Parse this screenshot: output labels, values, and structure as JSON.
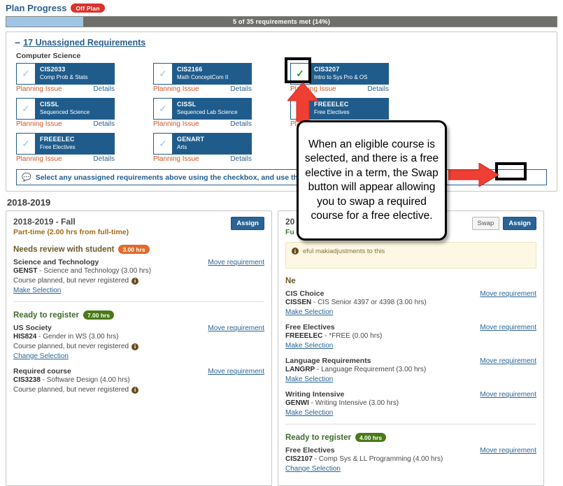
{
  "header": {
    "title": "Plan Progress",
    "badge": "Off Plan"
  },
  "progress": {
    "label": "5 of 35 requirements met (14%)",
    "percent": 14,
    "fill_color": "#9ec6e4",
    "track_color": "#6f6f6b"
  },
  "unassigned": {
    "collapse_icon": "minus-icon",
    "heading": "17 Unassigned Requirements",
    "group_title": "Computer Science",
    "hint_text": "Select any unassigned requirements above using the checkbox, and use the Assign o",
    "planning_issue_label": "Planning Issue",
    "details_label": "Details",
    "cards": [
      {
        "code": "CIS2033",
        "desc": "Comp Prob & Stats",
        "checked": true,
        "selected": false
      },
      {
        "code": "CIS2166",
        "desc": "Math ConceptCom II",
        "checked": true,
        "selected": false
      },
      {
        "code": "CIS3207",
        "desc": "Intro to Sys Pro & OS",
        "checked": true,
        "selected": true
      },
      {
        "code": "CISSL",
        "desc": "Sequenced  Science",
        "checked": true,
        "selected": false
      },
      {
        "code": "CISSL",
        "desc": "Sequenced Lab Science",
        "checked": true,
        "selected": false
      },
      {
        "code": "FREEELEC",
        "desc": "Free Electives",
        "checked": true,
        "selected": false
      },
      {
        "code": "FREEELEC",
        "desc": "Free Electives",
        "checked": true,
        "selected": false
      },
      {
        "code": "GENART",
        "desc": "Arts",
        "checked": true,
        "selected": false
      }
    ]
  },
  "year": {
    "label": "2018-2019"
  },
  "terms": [
    {
      "name": "2018-2019 - Fall",
      "status": "Part-time (2.00 hrs from full-time)",
      "status_type": "part",
      "assign_label": "Assign",
      "swap_label": null,
      "alert": null,
      "sections": [
        {
          "title": "Needs review with student",
          "badge": "3.00 hrs",
          "color": "orange",
          "items": [
            {
              "title": "Science and Technology",
              "move_label": "Move requirement",
              "code": "GENST",
              "detail": " - Science and Technology (3.00 hrs)",
              "note": "Course planned, but never registered",
              "link": "Make Selection"
            }
          ]
        },
        {
          "title": "Ready to register",
          "badge": "7.00 hrs",
          "color": "green",
          "items": [
            {
              "title": "US Society",
              "move_label": "Move requirement",
              "code": "HIS824",
              "detail": " - Gender in WS (3.00 hrs)",
              "note": "Course planned, but never registered",
              "link": "Change Selection"
            },
            {
              "title": "Required course",
              "move_label": "Move requirement",
              "code": "CIS3238",
              "detail": " - Software Design (4.00 hrs)",
              "note": "Course planned, but never registered",
              "link": null
            }
          ]
        }
      ]
    },
    {
      "name": "20",
      "status": "Fu",
      "status_type": "full",
      "assign_label": "Assign",
      "swap_label": "Swap",
      "alert": "eful makiadjustments to this",
      "sections": [
        {
          "title": "Ne",
          "badge": null,
          "color": "orange",
          "items": [
            {
              "title": "CIS Choice",
              "move_label": "Move requirement",
              "code": "CISSEN",
              "detail": " - CIS Senior 4397 or 4398 (3.00 hrs)",
              "note": null,
              "link": "Make Selection"
            },
            {
              "title": "Free Electives",
              "move_label": "Move requirement",
              "code": "FREEELEC",
              "detail": " - *FREE (0.00 hrs)",
              "note": null,
              "link": "Make Selection"
            },
            {
              "title": "Language Requirements",
              "move_label": "Move requirement",
              "code": "LANGRP",
              "detail": " - Language Requirement (3.00 hrs)",
              "note": null,
              "link": "Make Selection"
            },
            {
              "title": "Writing Intensive",
              "move_label": "Move requirement",
              "code": "GENWI",
              "detail": " - Writing Intensive (3.00 hrs)",
              "note": null,
              "link": "Make Selection"
            }
          ]
        },
        {
          "title": "Ready to register",
          "badge": "4.00 hrs",
          "color": "green",
          "items": [
            {
              "title": "Free Electives",
              "move_label": "Move requirement",
              "code": "CIS2107",
              "detail": " - Comp Sys & LL Programming (4.00 hrs)",
              "note": null,
              "link": "Change Selection"
            }
          ]
        }
      ]
    }
  ],
  "annotation": {
    "callout_text": "When an eligible course is selected, and there is a free elective in a term, the Swap button will appear allowing you to swap a required course for a free elective.",
    "arrow_color": "#ef3e33",
    "highlight_color": "#000000"
  }
}
